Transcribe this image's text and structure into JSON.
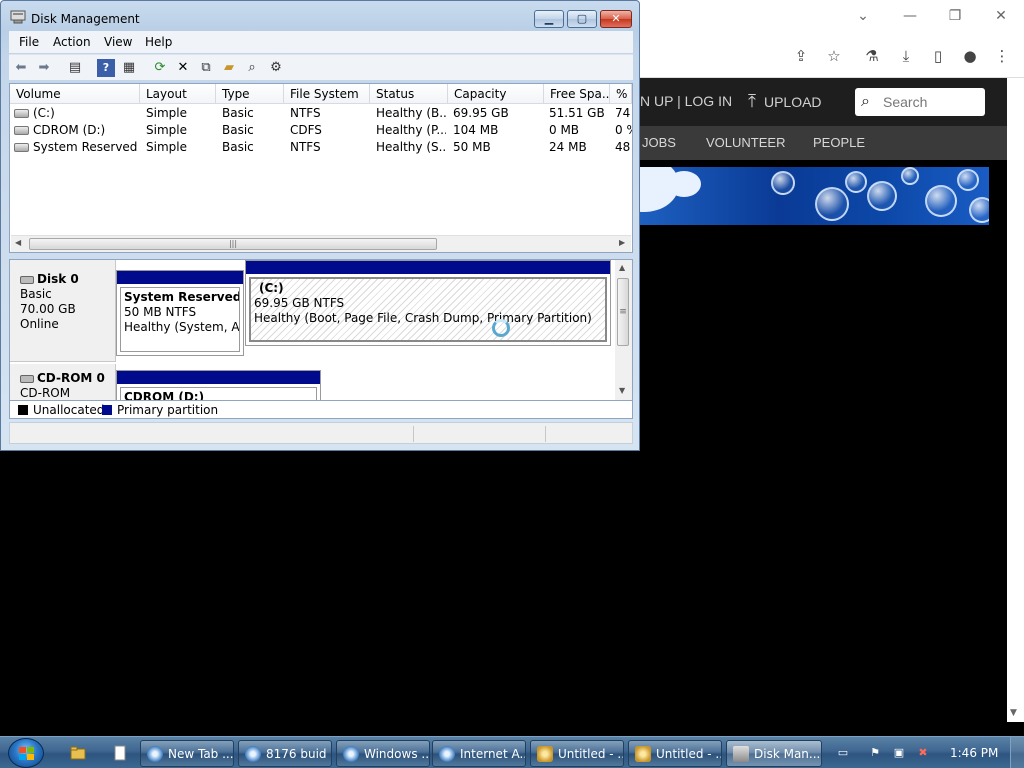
{
  "browser": {
    "header": {
      "login": "N UP | LOG IN",
      "upload": "UPLOAD",
      "search_placeholder": "Search"
    },
    "nav": [
      "JOBS",
      "VOLUNTEER",
      "PEOPLE"
    ]
  },
  "dm": {
    "title": "Disk Management",
    "menu": [
      "File",
      "Action",
      "View",
      "Help"
    ],
    "columns": [
      "Volume",
      "Layout",
      "Type",
      "File System",
      "Status",
      "Capacity",
      "Free Spa...",
      "% F"
    ],
    "volumes": [
      {
        "volume": "(C:)",
        "layout": "Simple",
        "type": "Basic",
        "fs": "NTFS",
        "status": "Healthy (B...",
        "capacity": "69.95 GB",
        "free": "51.51 GB",
        "pct": "74"
      },
      {
        "volume": "CDROM (D:)",
        "layout": "Simple",
        "type": "Basic",
        "fs": "CDFS",
        "status": "Healthy (P...",
        "capacity": "104 MB",
        "free": "0 MB",
        "pct": "0 %"
      },
      {
        "volume": "System Reserved",
        "layout": "Simple",
        "type": "Basic",
        "fs": "NTFS",
        "status": "Healthy (S...",
        "capacity": "50 MB",
        "free": "24 MB",
        "pct": "48"
      }
    ],
    "disks": [
      {
        "name": "Disk 0",
        "kind": "Basic",
        "size": "70.00 GB",
        "state": "Online",
        "partitions": [
          {
            "title": "System Reserved",
            "detail": "50 MB NTFS",
            "status": "Healthy (System, Acti"
          },
          {
            "title": "(C:)",
            "detail": "69.95 GB NTFS",
            "status": "Healthy (Boot, Page File, Crash Dump, Primary Partition)"
          }
        ]
      },
      {
        "name": "CD-ROM 0",
        "kind": "CD-ROM",
        "partitions": [
          {
            "title": "CDROM  (D:)"
          }
        ]
      }
    ],
    "legend": [
      {
        "label": "Unallocated",
        "color": "#000000"
      },
      {
        "label": "Primary partition",
        "color": "#000a8c"
      }
    ]
  },
  "taskbar": {
    "tasks": [
      "New Tab ...",
      "8176 buid ...",
      "Windows ...",
      "Internet A...",
      "Untitled - ...",
      "Untitled - ...",
      "Disk Man..."
    ],
    "clock": "1:46 PM"
  }
}
